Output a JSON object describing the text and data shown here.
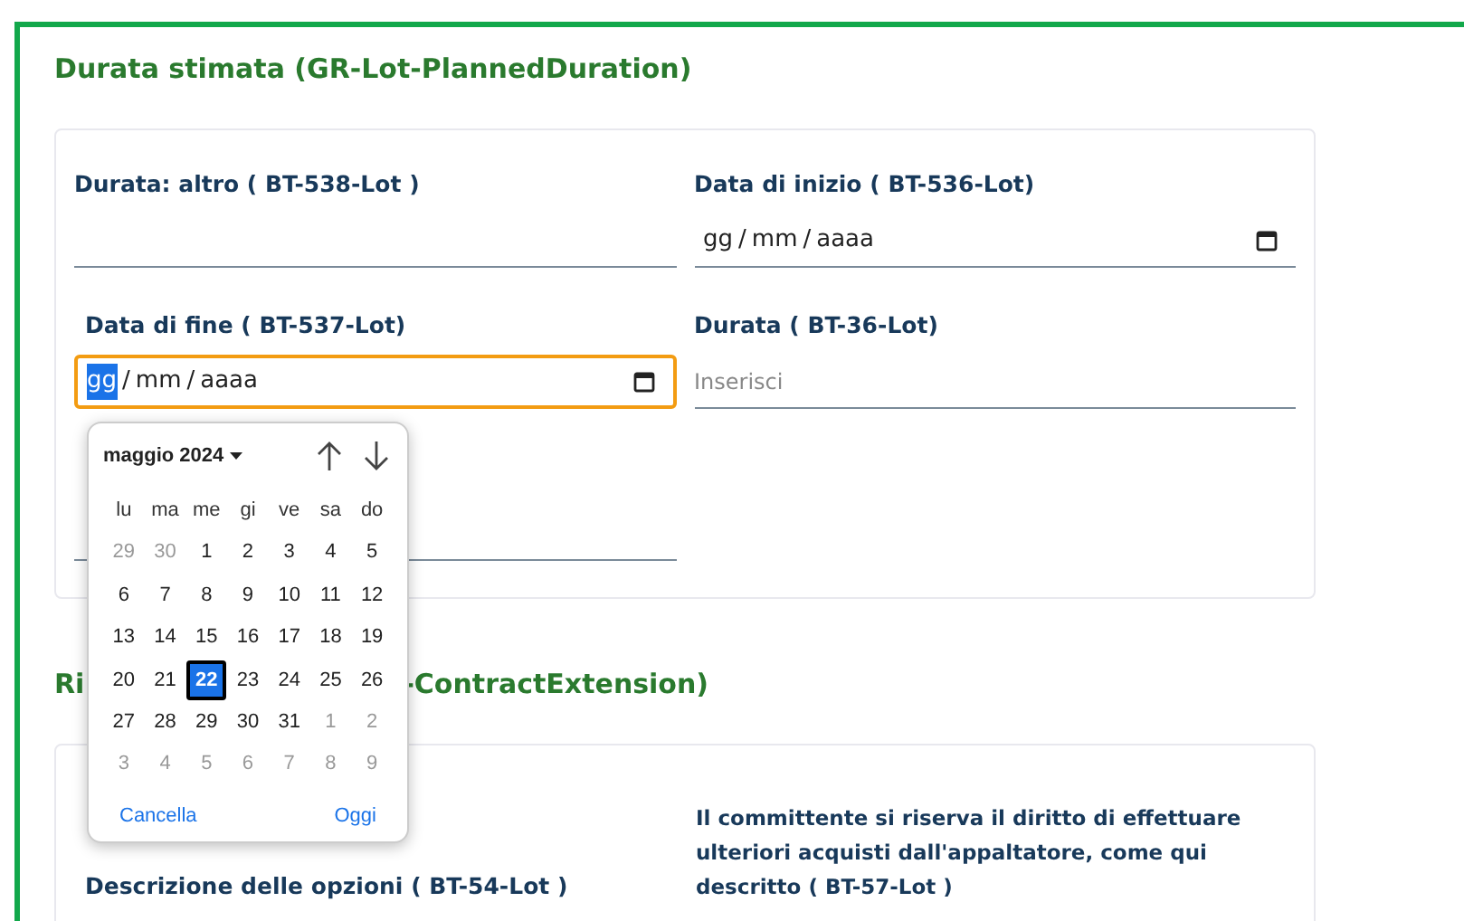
{
  "sections": [
    {
      "title_parts": [
        "Durata stimata (GR-Lot-PlannedDuration)"
      ],
      "fields": [
        {
          "kind": "text",
          "label": "Durata: altro ( BT-538-Lot )"
        },
        {
          "kind": "date",
          "label": "Data di inizio ( BT-536-Lot)",
          "segments": [
            {
              "text": "gg",
              "selected": false
            },
            {
              "text": "mm",
              "selected": false
            },
            {
              "text": "aaaa",
              "selected": false
            }
          ],
          "separator": "/",
          "focused": false
        },
        {
          "kind": "date",
          "label": "Data di fine ( BT-537-Lot)",
          "segments": [
            {
              "text": "gg",
              "selected": true
            },
            {
              "text": "mm",
              "selected": false
            },
            {
              "text": "aaaa",
              "selected": false
            }
          ],
          "separator": "/",
          "focused": true
        },
        {
          "kind": "text",
          "label": "Durata ( BT-36-Lot)",
          "placeholder": "Inserisci"
        },
        {
          "kind": "hidden"
        }
      ]
    },
    {
      "title_parts": [
        "Ri",
        "-ContractExtension)"
      ],
      "fields": [
        {
          "label": "Descrizione delle opzioni ( BT-54-Lot )"
        },
        {
          "label": "Il committente si riserva il diritto di effettuare ulteriori acquisti dall'appaltatore, come qui descritto ( BT-57-Lot )"
        }
      ]
    }
  ],
  "calendar": {
    "month": "maggio 2024",
    "weekdays": [
      "lu",
      "ma",
      "me",
      "gi",
      "ve",
      "sa",
      "do"
    ],
    "weeks": [
      [
        {
          "day": "29",
          "muted": true,
          "selected": false
        },
        {
          "day": "30",
          "muted": true,
          "selected": false
        },
        {
          "day": "1",
          "muted": false,
          "selected": false
        },
        {
          "day": "2",
          "muted": false,
          "selected": false
        },
        {
          "day": "3",
          "muted": false,
          "selected": false
        },
        {
          "day": "4",
          "muted": false,
          "selected": false
        },
        {
          "day": "5",
          "muted": false,
          "selected": false
        }
      ],
      [
        {
          "day": "6",
          "muted": false,
          "selected": false
        },
        {
          "day": "7",
          "muted": false,
          "selected": false
        },
        {
          "day": "8",
          "muted": false,
          "selected": false
        },
        {
          "day": "9",
          "muted": false,
          "selected": false
        },
        {
          "day": "10",
          "muted": false,
          "selected": false
        },
        {
          "day": "11",
          "muted": false,
          "selected": false
        },
        {
          "day": "12",
          "muted": false,
          "selected": false
        }
      ],
      [
        {
          "day": "13",
          "muted": false,
          "selected": false
        },
        {
          "day": "14",
          "muted": false,
          "selected": false
        },
        {
          "day": "15",
          "muted": false,
          "selected": false
        },
        {
          "day": "16",
          "muted": false,
          "selected": false
        },
        {
          "day": "17",
          "muted": false,
          "selected": false
        },
        {
          "day": "18",
          "muted": false,
          "selected": false
        },
        {
          "day": "19",
          "muted": false,
          "selected": false
        }
      ],
      [
        {
          "day": "20",
          "muted": false,
          "selected": false
        },
        {
          "day": "21",
          "muted": false,
          "selected": false
        },
        {
          "day": "22",
          "muted": false,
          "selected": true
        },
        {
          "day": "23",
          "muted": false,
          "selected": false
        },
        {
          "day": "24",
          "muted": false,
          "selected": false
        },
        {
          "day": "25",
          "muted": false,
          "selected": false
        },
        {
          "day": "26",
          "muted": false,
          "selected": false
        }
      ],
      [
        {
          "day": "27",
          "muted": false,
          "selected": false
        },
        {
          "day": "28",
          "muted": false,
          "selected": false
        },
        {
          "day": "29",
          "muted": false,
          "selected": false
        },
        {
          "day": "30",
          "muted": false,
          "selected": false
        },
        {
          "day": "31",
          "muted": false,
          "selected": false
        },
        {
          "day": "1",
          "muted": true,
          "selected": false
        },
        {
          "day": "2",
          "muted": true,
          "selected": false
        }
      ],
      [
        {
          "day": "3",
          "muted": true,
          "selected": false
        },
        {
          "day": "4",
          "muted": true,
          "selected": false
        },
        {
          "day": "5",
          "muted": true,
          "selected": false
        },
        {
          "day": "6",
          "muted": true,
          "selected": false
        },
        {
          "day": "7",
          "muted": true,
          "selected": false
        },
        {
          "day": "8",
          "muted": true,
          "selected": false
        },
        {
          "day": "9",
          "muted": true,
          "selected": false
        }
      ]
    ],
    "clear": "Cancella",
    "today": "Oggi"
  }
}
